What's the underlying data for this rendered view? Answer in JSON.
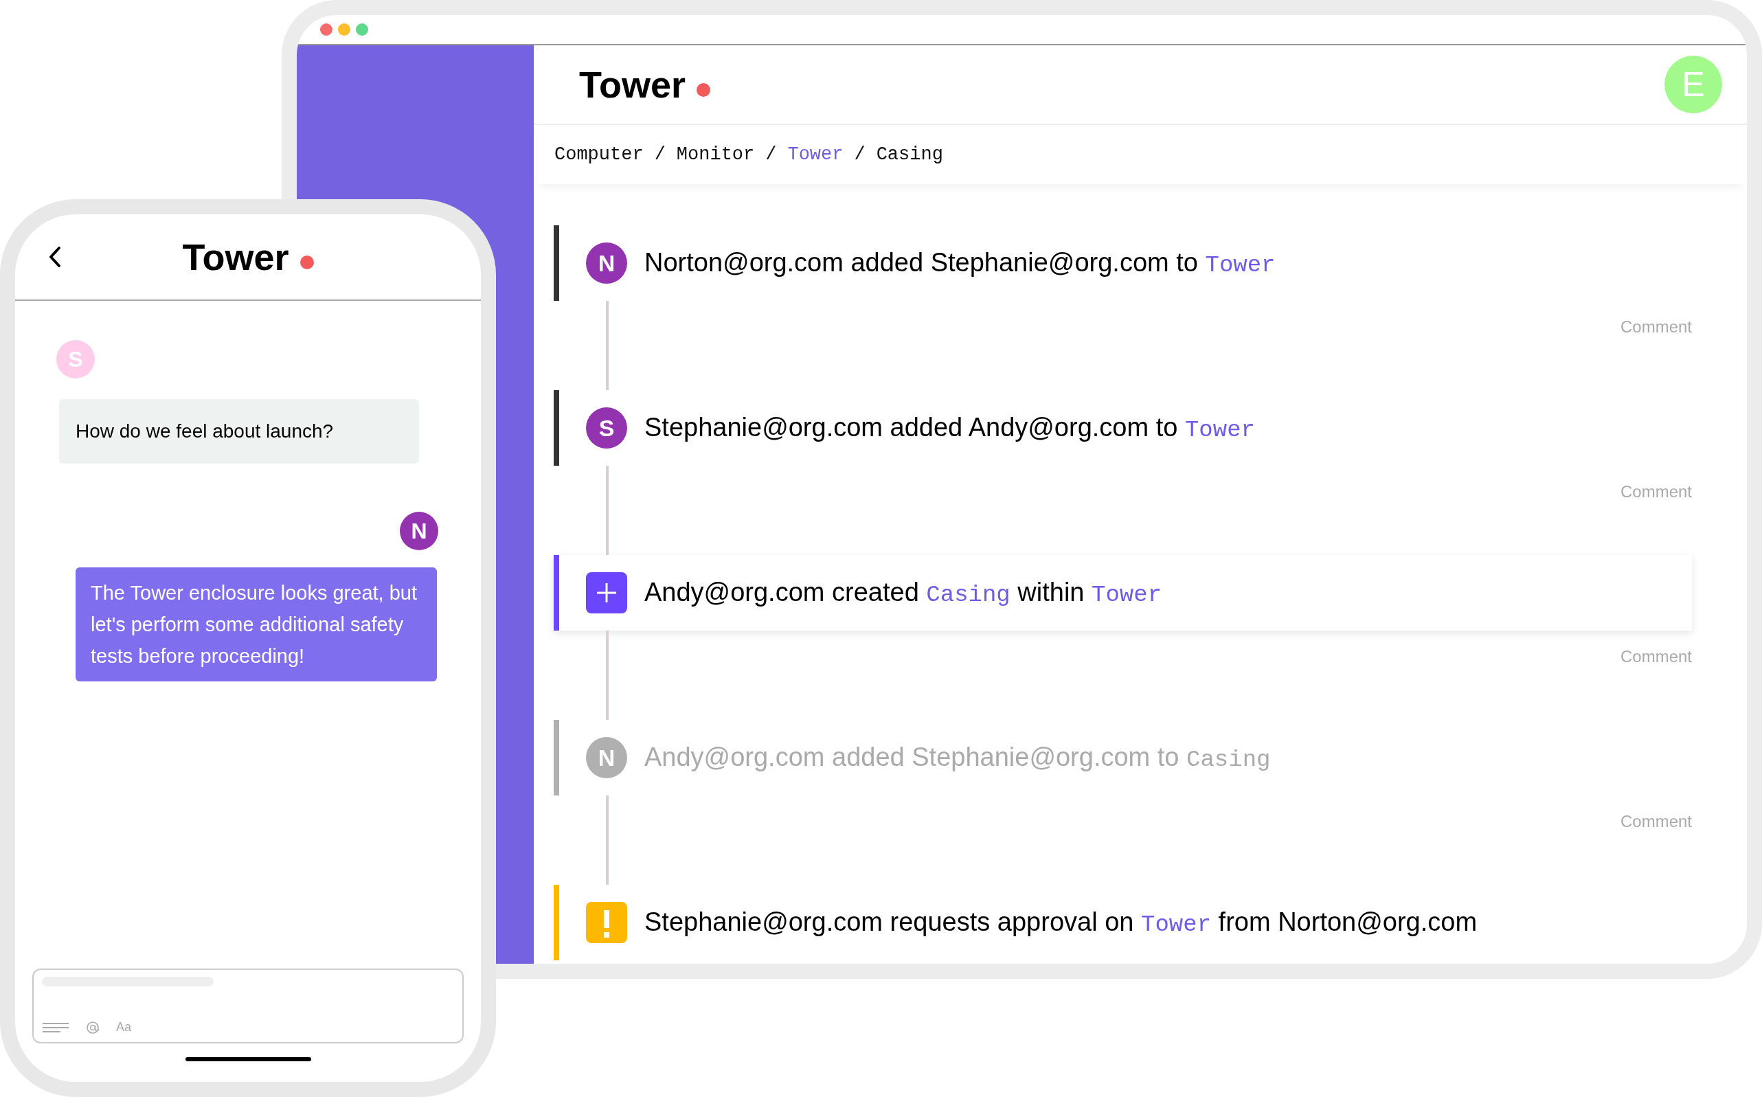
{
  "desktop": {
    "title": "Tower",
    "avatar": "E",
    "breadcrumb_separator": "/",
    "breadcrumb": [
      {
        "label": "Computer",
        "link": false
      },
      {
        "label": "Monitor",
        "link": false
      },
      {
        "label": "Tower",
        "link": true
      },
      {
        "label": "Casing",
        "link": false
      }
    ],
    "feed": [
      {
        "kind": "avatar",
        "initial": "N",
        "color": "#333333",
        "selected": false,
        "dimmed": false,
        "parts": [
          {
            "text": "Norton@org.com added Stephanie@org.com to ",
            "link": false
          },
          {
            "text": "Tower",
            "link": true
          }
        ],
        "comment": "Comment"
      },
      {
        "kind": "avatar",
        "initial": "S",
        "color": "#333333",
        "selected": false,
        "dimmed": false,
        "parts": [
          {
            "text": "Stephanie@org.com added Andy@org.com to ",
            "link": false
          },
          {
            "text": "Tower",
            "link": true
          }
        ],
        "comment": "Comment"
      },
      {
        "kind": "created",
        "color": "#6b45ff",
        "selected": true,
        "dimmed": false,
        "parts": [
          {
            "text": "Andy@org.com created ",
            "link": false
          },
          {
            "text": "Casing",
            "link": true
          },
          {
            "text": " within ",
            "link": false
          },
          {
            "text": "Tower",
            "link": true
          }
        ],
        "comment": "Comment"
      },
      {
        "kind": "avatar",
        "initial": "N",
        "color": "#b0b0b0",
        "selected": false,
        "dimmed": true,
        "parts": [
          {
            "text": "Andy@org.com added Stephanie@org.com to ",
            "link": false
          },
          {
            "text": "Casing",
            "link": true
          }
        ],
        "comment": "Comment"
      },
      {
        "kind": "approval",
        "color": "#ffb800",
        "selected": false,
        "dimmed": false,
        "parts": [
          {
            "text": "Stephanie@org.com requests approval on ",
            "link": false
          },
          {
            "text": "Tower",
            "link": true
          },
          {
            "text": " from Norton@org.com",
            "link": false
          }
        ]
      }
    ]
  },
  "phone": {
    "title": "Tower",
    "messages": [
      {
        "sender": "S",
        "color": "#ffcde9",
        "outgoing": false,
        "text": "How do we feel about launch?"
      },
      {
        "sender": "N",
        "color": "#9333b0",
        "outgoing": true,
        "text": "The Tower enclosure looks great, but let's perform some additional safety tests before proceeding!"
      }
    ],
    "compose": {
      "format_label": "Aa"
    }
  }
}
